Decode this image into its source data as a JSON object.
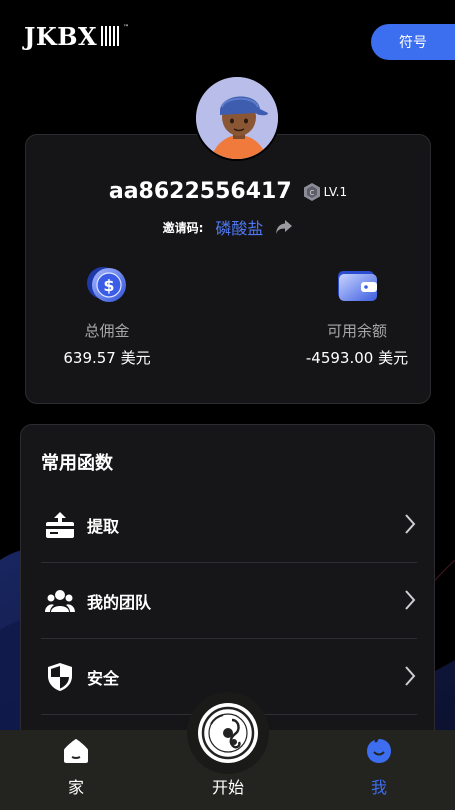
{
  "header": {
    "logo_text": "JKBX",
    "logo_tm": "™",
    "symbol_button": "符号"
  },
  "profile": {
    "username": "aa8622556417",
    "level": "LV.1",
    "invite_label": "邀请码:",
    "invite_code": "磷酸盐",
    "commission_label": "总佣金",
    "commission_value": "639.57 美元",
    "balance_label": "可用余额",
    "balance_value": "-4593.00 美元"
  },
  "functions": {
    "title": "常用函数",
    "items": [
      {
        "label": "提取",
        "icon": "withdraw-icon"
      },
      {
        "label": "我的团队",
        "icon": "team-icon"
      },
      {
        "label": "安全",
        "icon": "shield-icon"
      }
    ]
  },
  "nav": {
    "home": "家",
    "start": "开始",
    "me": "我"
  },
  "colors": {
    "accent": "#3c6ef0",
    "card_bg": "#151517",
    "nav_bg": "#232320"
  }
}
